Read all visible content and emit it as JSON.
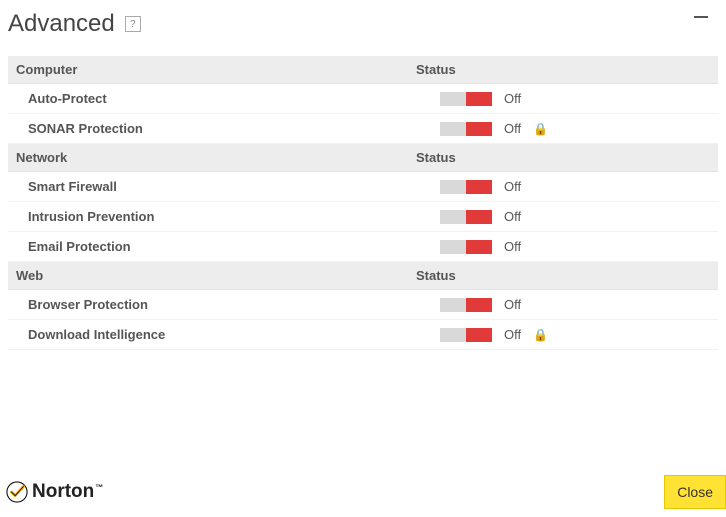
{
  "header": {
    "title": "Advanced",
    "help_glyph": "?"
  },
  "columns": {
    "name": "",
    "status": "Status"
  },
  "sections": [
    {
      "title": "Computer",
      "items": [
        {
          "label": "Auto-Protect",
          "status": "Off",
          "locked": false
        },
        {
          "label": "SONAR Protection",
          "status": "Off",
          "locked": true
        }
      ]
    },
    {
      "title": "Network",
      "items": [
        {
          "label": "Smart Firewall",
          "status": "Off",
          "locked": false
        },
        {
          "label": "Intrusion Prevention",
          "status": "Off",
          "locked": false
        },
        {
          "label": "Email Protection",
          "status": "Off",
          "locked": false
        }
      ]
    },
    {
      "title": "Web",
      "items": [
        {
          "label": "Browser Protection",
          "status": "Off",
          "locked": false
        },
        {
          "label": "Download Intelligence",
          "status": "Off",
          "locked": true
        }
      ]
    }
  ],
  "footer": {
    "brand": "Norton",
    "close": "Close"
  }
}
